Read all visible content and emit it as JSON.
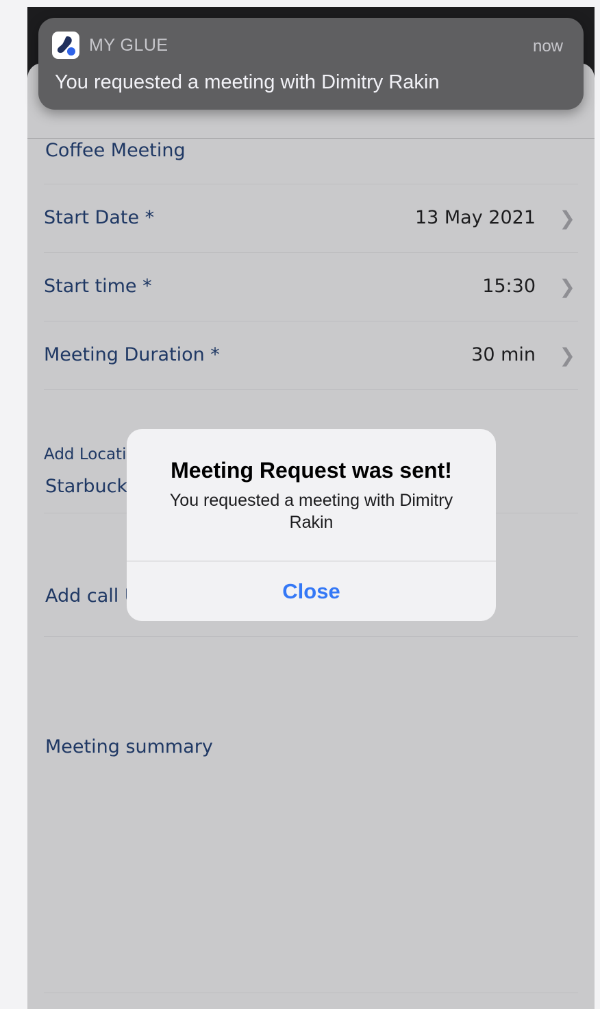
{
  "notification": {
    "app_name": "MY GLUE",
    "time": "now",
    "message": "You requested a meeting with Dimitry Rakin",
    "icon": "my-glue-app-icon"
  },
  "form": {
    "meeting_title": "Coffee Meeting",
    "rows": [
      {
        "label": "Start Date *",
        "value": "13 May 2021"
      },
      {
        "label": "Start time *",
        "value": "15:30"
      },
      {
        "label": "Meeting Duration *",
        "value": "30 min"
      }
    ],
    "location_label": "Add Locatio",
    "location_value": "Starbucks",
    "call_url_label": "Add call U",
    "summary_label": "Meeting summary"
  },
  "alert": {
    "title": "Meeting Request was sent!",
    "message": "You requested a meeting with Dimitry Rakin",
    "close_label": "Close"
  },
  "colors": {
    "accent": "#3478f6",
    "label_navy": "#1f3864",
    "dimmed_sheet": "#c9c9cb",
    "banner_bg": "#5f5f61"
  }
}
